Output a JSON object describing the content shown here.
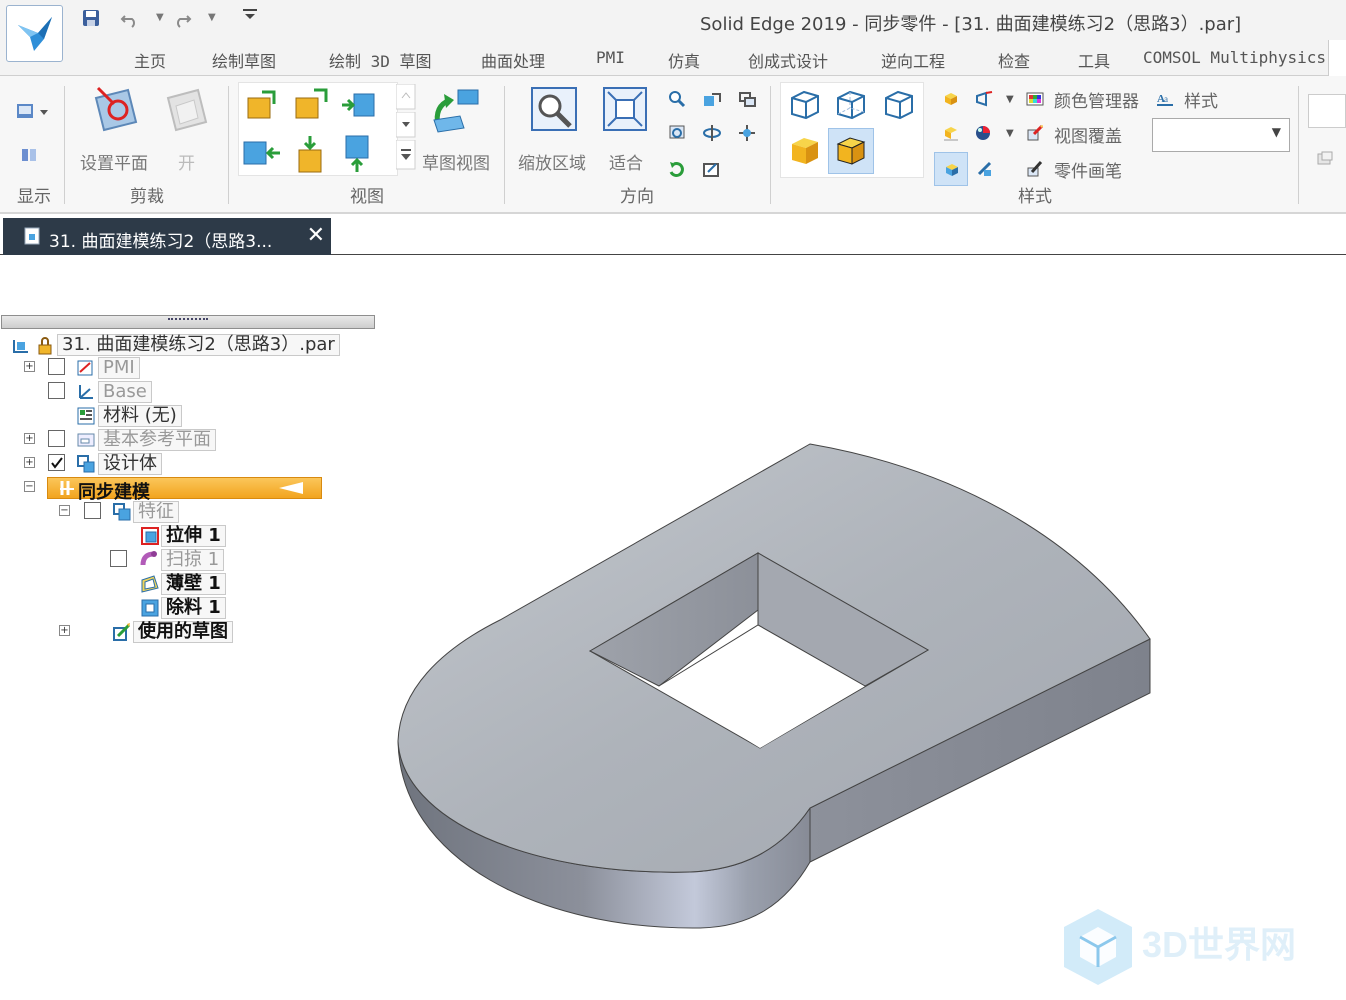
{
  "app": {
    "window_title": "Solid Edge 2019 - 同步零件 - [31. 曲面建模练习2（思路3）.par]"
  },
  "menu": {
    "tabs": [
      "主页",
      "绘制草图",
      "绘制 3D 草图",
      "曲面处理",
      "PMI",
      "仿真",
      "创成式设计",
      "逆向工程",
      "检查",
      "工具",
      "COMSOL Multiphysics"
    ]
  },
  "ribbon": {
    "groups": {
      "display": "显示",
      "clip": "剪裁",
      "view": "视图",
      "orient": "方向",
      "style": "样式"
    },
    "buttons": {
      "set_plane": "设置平面",
      "open": "开",
      "sketch_view": "草图视图",
      "zoom_area": "缩放区域",
      "fit": "适合",
      "color_manager": "颜色管理器",
      "view_override": "视图覆盖",
      "part_painter": "零件画笔",
      "styles": "样式"
    },
    "style_dropdown_value": ""
  },
  "document_tab": {
    "label": "31. 曲面建模练习2（思路3...",
    "close": "✕"
  },
  "tree": {
    "root": "31. 曲面建模练习2（思路3）.par",
    "pmi": "PMI",
    "base": "Base",
    "material": "材料 (无)",
    "ref_planes": "基本参考平面",
    "design_body": "设计体",
    "sync_modeling": "同步建模",
    "features": "特征",
    "extrude": "拉伸 1",
    "sweep": "扫掠 1",
    "thin_wall": "薄壁 1",
    "cutout": "除料 1",
    "used_sketches": "使用的草图"
  },
  "watermark": {
    "text": "3D世界网"
  },
  "colors": {
    "doc_tab_bg": "#2d3a48",
    "sync_highlight": "#f7b13a",
    "model_top": "#aeb4bc",
    "model_side": "#8b909c"
  }
}
